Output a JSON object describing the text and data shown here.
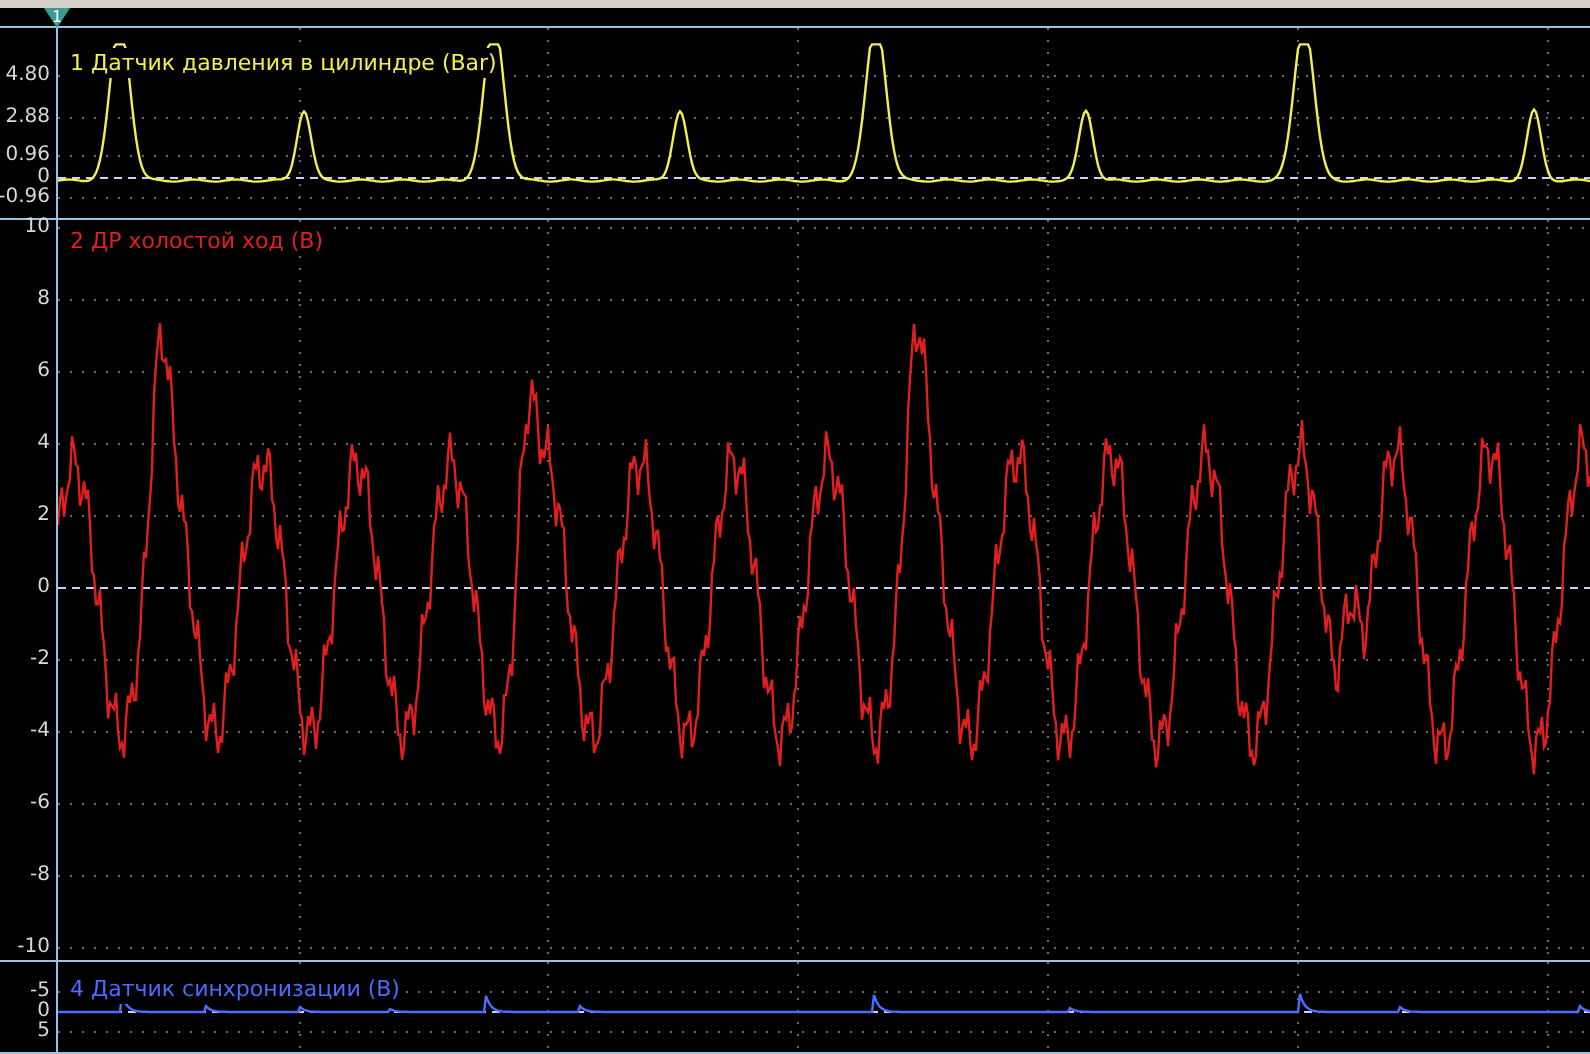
{
  "marker": {
    "label": "1"
  },
  "panes": [
    {
      "label": "1 Датчик давления в цилиндре (Bar)",
      "color": "#f0f050",
      "ticks": [
        "4.80",
        "2.88",
        "0.96",
        "0",
        "-0.96"
      ]
    },
    {
      "label": "2 ДР холостой ход (В)",
      "color": "#e02020",
      "ticks": [
        "10",
        "8",
        "6",
        "4",
        "2",
        "0",
        "-2",
        "-4",
        "-6",
        "-8",
        "-10"
      ]
    },
    {
      "label": "4 Датчик синхронизации (В)",
      "color": "#4a6cff",
      "ticks": [
        "-5",
        "0",
        "5"
      ]
    }
  ]
}
